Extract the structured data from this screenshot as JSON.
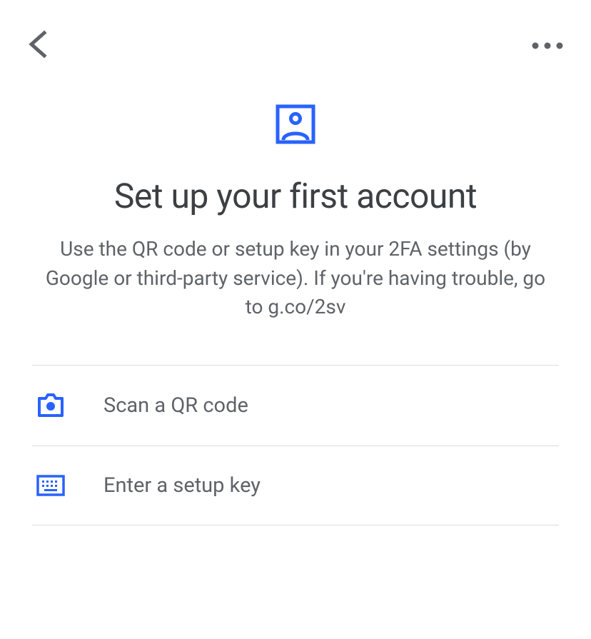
{
  "hero": {
    "title": "Set up your first account",
    "subtitle": "Use the QR code or setup key in your 2FA settings (by Google or third-party service). If you're having trouble, go to g.co/2sv"
  },
  "options": {
    "scan_qr_label": "Scan a QR code",
    "enter_key_label": "Enter a setup key"
  },
  "colors": {
    "accent": "#2962ff",
    "text_primary": "#3c4043",
    "text_secondary": "#5f6368",
    "divider": "#dadce0"
  }
}
